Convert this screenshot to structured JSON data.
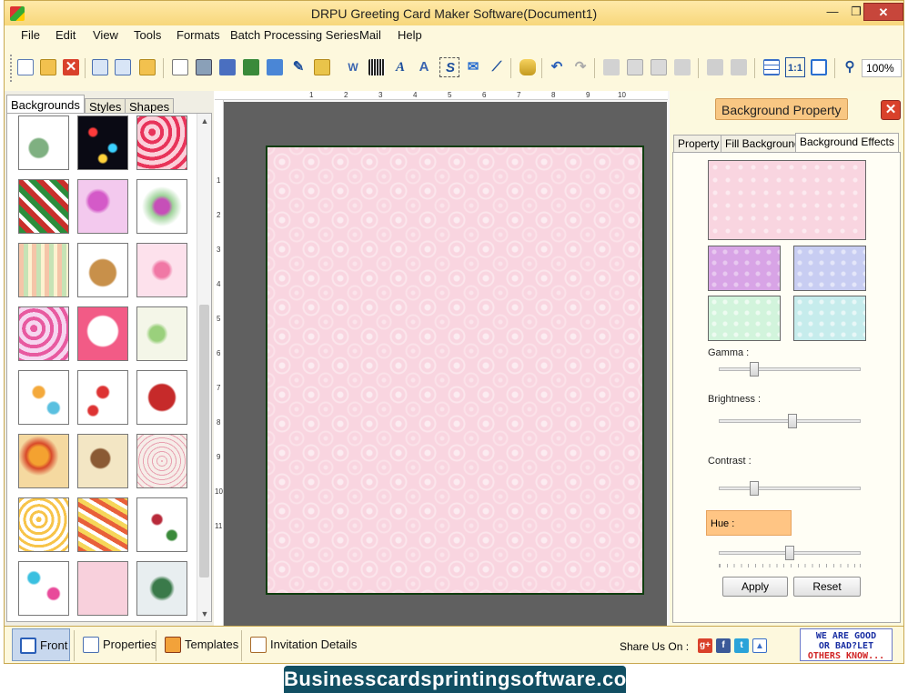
{
  "window": {
    "title": "DRPU Greeting Card Maker Software(Document1)"
  },
  "menu": [
    "File",
    "Edit",
    "View",
    "Tools",
    "Formats",
    "Batch Processing Series",
    "Mail",
    "Help"
  ],
  "toolbar": {
    "zoom": "100%"
  },
  "left_panel": {
    "tabs": [
      "Backgrounds",
      "Styles",
      "Shapes"
    ],
    "active_tab": "Backgrounds"
  },
  "ruler": {
    "top_marks": [
      "1",
      "2",
      "3",
      "4",
      "5",
      "6",
      "7",
      "8",
      "9",
      "10"
    ],
    "left_marks": [
      "1",
      "2",
      "3",
      "4",
      "5",
      "6",
      "7",
      "8",
      "9",
      "10",
      "11"
    ]
  },
  "properties": {
    "title": "Background Property",
    "tabs": [
      "Property",
      "Fill Background",
      "Background Effects"
    ],
    "active_tab": "Background Effects",
    "sliders": [
      {
        "label": "Gamma :",
        "level": 0.23
      },
      {
        "label": "Brightness :",
        "level": 0.52
      },
      {
        "label": "Contrast :",
        "level": 0.23
      },
      {
        "label": "Hue :",
        "level": 0.5
      }
    ],
    "apply_label": "Apply",
    "reset_label": "Reset"
  },
  "bottom_bar": {
    "buttons": [
      "Front",
      "Properties",
      "Templates",
      "Invitation Details"
    ],
    "share_label": "Share Us On :",
    "feedback_lines": [
      "WE ARE GOOD",
      "OR BAD?LET",
      "OTHERS KNOW..."
    ]
  },
  "banner": "Businesscardsprintingsoftware.com",
  "colors": {
    "title_bar": "#f7d77b",
    "property_header": "#f8c783",
    "banner_bg": "#114f63",
    "card_background": "#f9d5e0"
  }
}
